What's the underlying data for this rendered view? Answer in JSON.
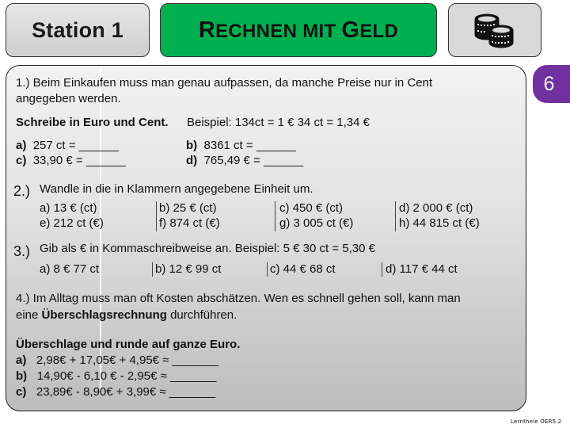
{
  "header": {
    "station_label": "Station 1",
    "title_first_big": "R",
    "title_first_rest": "ECHNEN MIT ",
    "title_second_big": "G",
    "title_second_rest": "ELD",
    "icon": "coins-icon"
  },
  "badge": {
    "value": "6",
    "color": "#7030a0"
  },
  "colors": {
    "title_green": "#00b050",
    "badge_purple": "#7030a0",
    "panel_grey": "#d9d9d9"
  },
  "task1": {
    "intro_line1": "1.) Beim Einkaufen muss man genau aufpassen, da manche Preise nur in Cent",
    "intro_line2": "angegeben werden.",
    "instruction": "Schreibe in Euro und Cent.",
    "example": "Beispiel: 134ct = 1 € 34 ct = 1,34 €",
    "items": [
      {
        "label": "a)",
        "text": "257 ct   = ______"
      },
      {
        "label": "b)",
        "text": "8361 ct   = ______"
      },
      {
        "label": "c)",
        "text": "33,90 € = ______"
      },
      {
        "label": "d)",
        "text": "765,49 € = ______"
      }
    ]
  },
  "task2": {
    "number": "2.)",
    "instruction": "Wandle in die in Klammern angegebene Einheit um.",
    "items": [
      "a) 13 € (ct)",
      "b) 25 € (ct)",
      "c) 450 € (ct)",
      "d) 2 000 € (ct)",
      "e) 212 ct (€)",
      "f)  874 ct (€)",
      "g) 3 005 ct (€)",
      "h) 44 815 ct (€)"
    ]
  },
  "task3": {
    "number": "3.)",
    "instruction": "Gib als € in Kommaschreibweise an. Beispiel: 5 € 30 ct = 5,30 €",
    "items": [
      "a) 8 € 77 ct",
      "b) 12 € 99 ct",
      "c) 44 € 68 ct",
      "d) 117 € 44 ct"
    ]
  },
  "task4": {
    "intro_line1": "4.) Im Alltag muss man oft Kosten abschätzen. Wen es schnell gehen soll, kann man",
    "intro_line2_pre": "eine ",
    "intro_line2_bold": "Überschlagsrechnung",
    "intro_line2_post": " durchführen.",
    "instruction": "Überschlage und runde auf ganze Euro.",
    "items": [
      {
        "label": "a)",
        "text": "2,98€ + 17,05€ + 4,95€ ≈ _______"
      },
      {
        "label": "b)",
        "text": "14,90€ - 6,10 € - 2,95€ ≈ _______"
      },
      {
        "label": "c)",
        "text": "23,89€ - 8,90€ + 3,99€ ≈ _______"
      }
    ]
  },
  "footer": "Lernthele OER5.2"
}
